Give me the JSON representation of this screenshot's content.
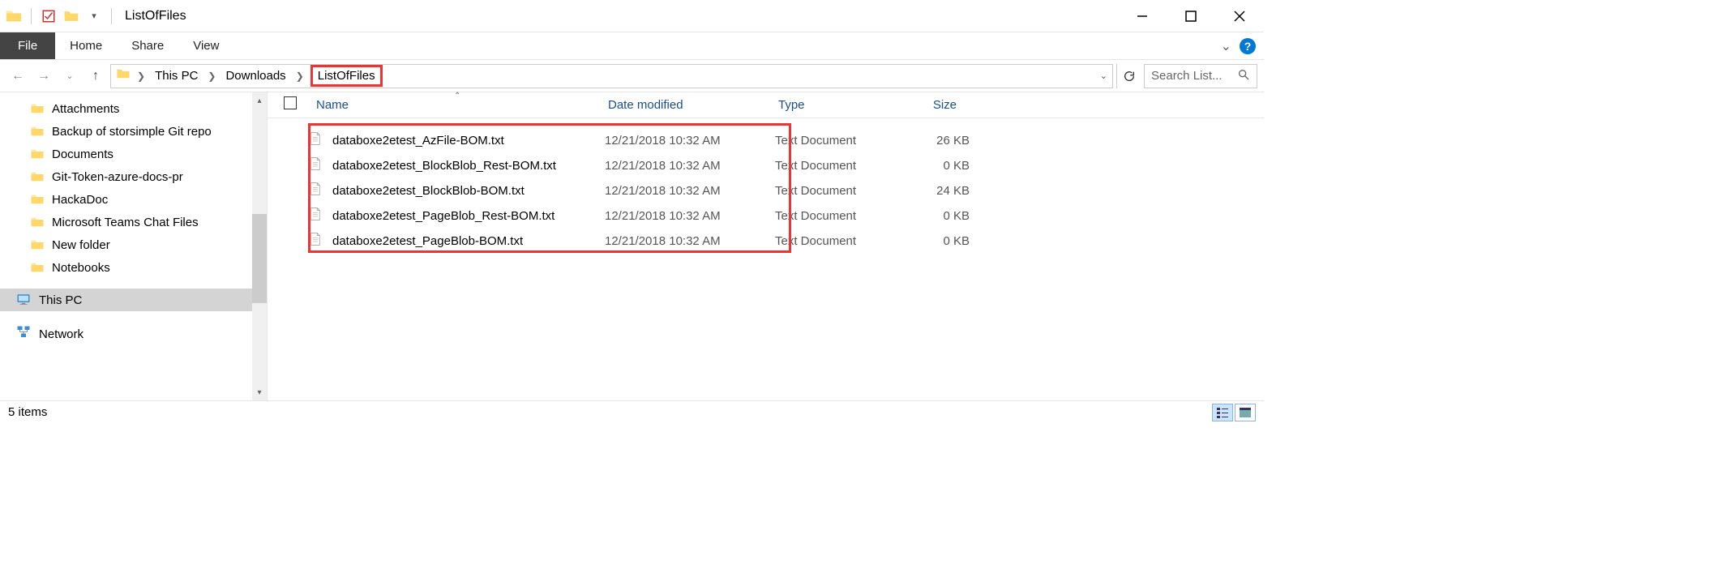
{
  "window": {
    "title": "ListOfFiles"
  },
  "ribbon": {
    "tabs": {
      "file": "File",
      "home": "Home",
      "share": "Share",
      "view": "View"
    }
  },
  "breadcrumb": {
    "items": [
      "This PC",
      "Downloads",
      "ListOfFiles"
    ]
  },
  "search": {
    "placeholder": "Search List..."
  },
  "sidebar": {
    "items": [
      "Attachments",
      "Backup of storsimple Git repo",
      "Documents",
      "Git-Token-azure-docs-pr",
      "HackaDoc",
      "Microsoft Teams Chat Files",
      "New folder",
      "Notebooks"
    ],
    "thispc": "This PC",
    "network": "Network"
  },
  "columns": {
    "name": "Name",
    "date": "Date modified",
    "type": "Type",
    "size": "Size"
  },
  "files": [
    {
      "name": "databoxe2etest_AzFile-BOM.txt",
      "date": "12/21/2018 10:32 AM",
      "type": "Text Document",
      "size": "26 KB"
    },
    {
      "name": "databoxe2etest_BlockBlob_Rest-BOM.txt",
      "date": "12/21/2018 10:32 AM",
      "type": "Text Document",
      "size": "0 KB"
    },
    {
      "name": "databoxe2etest_BlockBlob-BOM.txt",
      "date": "12/21/2018 10:32 AM",
      "type": "Text Document",
      "size": "24 KB"
    },
    {
      "name": "databoxe2etest_PageBlob_Rest-BOM.txt",
      "date": "12/21/2018 10:32 AM",
      "type": "Text Document",
      "size": "0 KB"
    },
    {
      "name": "databoxe2etest_PageBlob-BOM.txt",
      "date": "12/21/2018 10:32 AM",
      "type": "Text Document",
      "size": "0 KB"
    }
  ],
  "status": {
    "count": "5 items"
  }
}
